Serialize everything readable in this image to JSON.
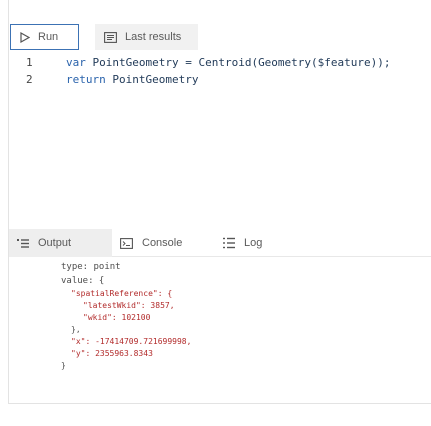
{
  "toolbar": {
    "run_label": "Run",
    "last_results_label": "Last results"
  },
  "editor": {
    "lines": [
      {
        "number": "1",
        "kw": "var ",
        "text": "PointGeometry = Centroid(Geometry($feature));"
      },
      {
        "number": "2",
        "kw": "return ",
        "text": "PointGeometry"
      }
    ]
  },
  "tabs": [
    {
      "label": "Output",
      "active": true
    },
    {
      "label": "Console",
      "active": false
    },
    {
      "label": "Log",
      "active": false
    }
  ],
  "output": {
    "type_line": "type: point",
    "value_open": "value: {",
    "spatial_key": "\"spatialReference\": {",
    "latest_wkid": "\"latestWkid\": 3857,",
    "wkid": "\"wkid\": 102100",
    "spatial_close": "},",
    "x": "\"x\": -17414709.721699998,",
    "y": "\"y\": 2355963.8343",
    "value_close": "}"
  },
  "colors": {
    "run_border": "#3c72b4",
    "keyword": "#2a63ac",
    "string": "#b22b2b"
  }
}
